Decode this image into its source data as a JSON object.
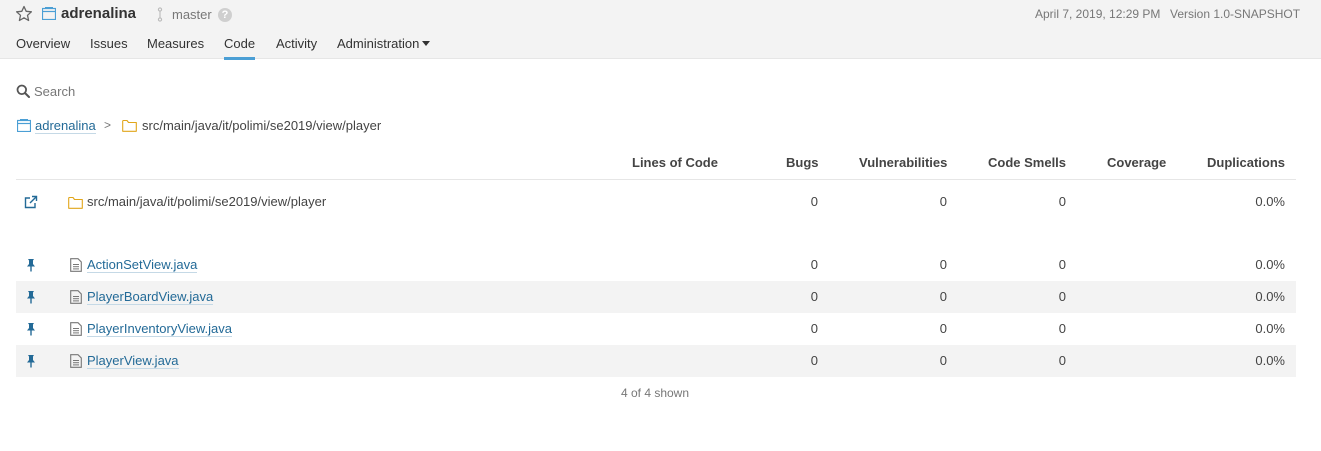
{
  "header": {
    "project_name": "adrenalina",
    "branch": "master",
    "help_symbol": "?",
    "date": "April 7, 2019, 12:29 PM",
    "version": "Version 1.0-SNAPSHOT",
    "favorite_icon": "star-outline-icon",
    "project_icon": "project-icon",
    "branch_icon": "branch-icon"
  },
  "nav": {
    "tabs": [
      {
        "label": "Overview"
      },
      {
        "label": "Issues"
      },
      {
        "label": "Measures"
      },
      {
        "label": "Code",
        "active": true
      },
      {
        "label": "Activity"
      },
      {
        "label": "Administration",
        "dropdown": true
      }
    ]
  },
  "search": {
    "placeholder": "Search",
    "value": ""
  },
  "breadcrumb": {
    "project": "adrenalina",
    "separator": ">",
    "path": "src/main/java/it/polimi/se2019/view/player"
  },
  "table": {
    "columns": [
      "Lines of Code",
      "Bugs",
      "Vulnerabilities",
      "Code Smells",
      "Coverage",
      "Duplications"
    ],
    "base_row": {
      "name": "src/main/java/it/polimi/se2019/view/player",
      "lines_of_code": "",
      "bugs": "0",
      "vulnerabilities": "0",
      "code_smells": "0",
      "coverage": "",
      "duplications": "0.0%"
    },
    "rows": [
      {
        "name": "ActionSetView.java",
        "lines_of_code": "",
        "bugs": "0",
        "vulnerabilities": "0",
        "code_smells": "0",
        "coverage": "",
        "duplications": "0.0%"
      },
      {
        "name": "PlayerBoardView.java",
        "lines_of_code": "",
        "bugs": "0",
        "vulnerabilities": "0",
        "code_smells": "0",
        "coverage": "",
        "duplications": "0.0%"
      },
      {
        "name": "PlayerInventoryView.java",
        "lines_of_code": "",
        "bugs": "0",
        "vulnerabilities": "0",
        "code_smells": "0",
        "coverage": "",
        "duplications": "0.0%"
      },
      {
        "name": "PlayerView.java",
        "lines_of_code": "",
        "bugs": "0",
        "vulnerabilities": "0",
        "code_smells": "0",
        "coverage": "",
        "duplications": "0.0%"
      }
    ],
    "footer": "4 of 4 shown"
  },
  "colors": {
    "link": "#236a97",
    "active_tab": "#4b9fd5",
    "folder": "#e1a61b",
    "header_bg": "#f3f3f3"
  }
}
